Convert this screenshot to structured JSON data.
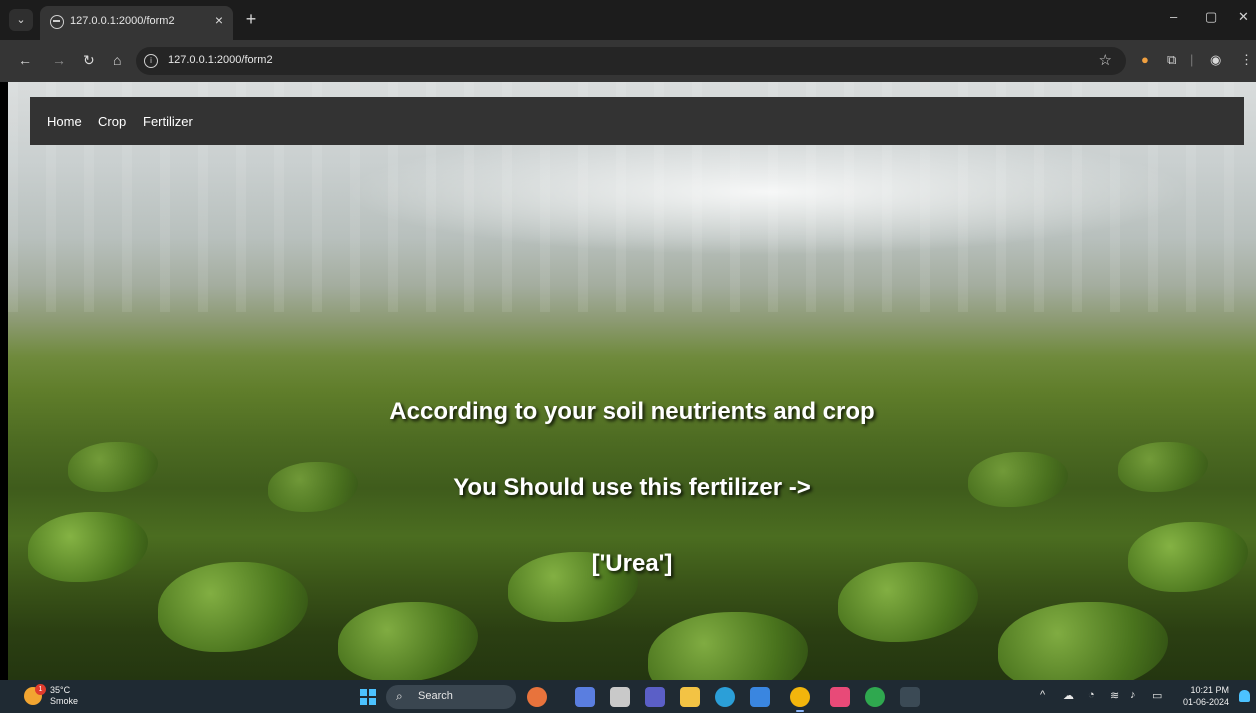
{
  "browser": {
    "tab_title": "127.0.0.1:2000/form2",
    "tab_close": "×",
    "new_tab": "+",
    "url": "127.0.0.1:2000/form2",
    "window_controls": [
      "–",
      "▢",
      "✕"
    ]
  },
  "nav": {
    "items": [
      {
        "label": "Home"
      },
      {
        "label": "Crop"
      },
      {
        "label": "Fertilizer"
      }
    ]
  },
  "result": {
    "line1": "According to your soil neutrients and crop",
    "line2": "You Should use this fertilizer ->",
    "line3": "['Urea']"
  },
  "taskbar": {
    "weather_temp": "35°C",
    "weather_desc": "Smoke",
    "weather_badge": "1",
    "search_label": "Search",
    "time": "10:21 PM",
    "date": "01-06-2024"
  },
  "colors": {
    "navbar_bg": "#333333",
    "taskbar_bg": "#1f2a33",
    "accent": "#4cc2ff"
  }
}
